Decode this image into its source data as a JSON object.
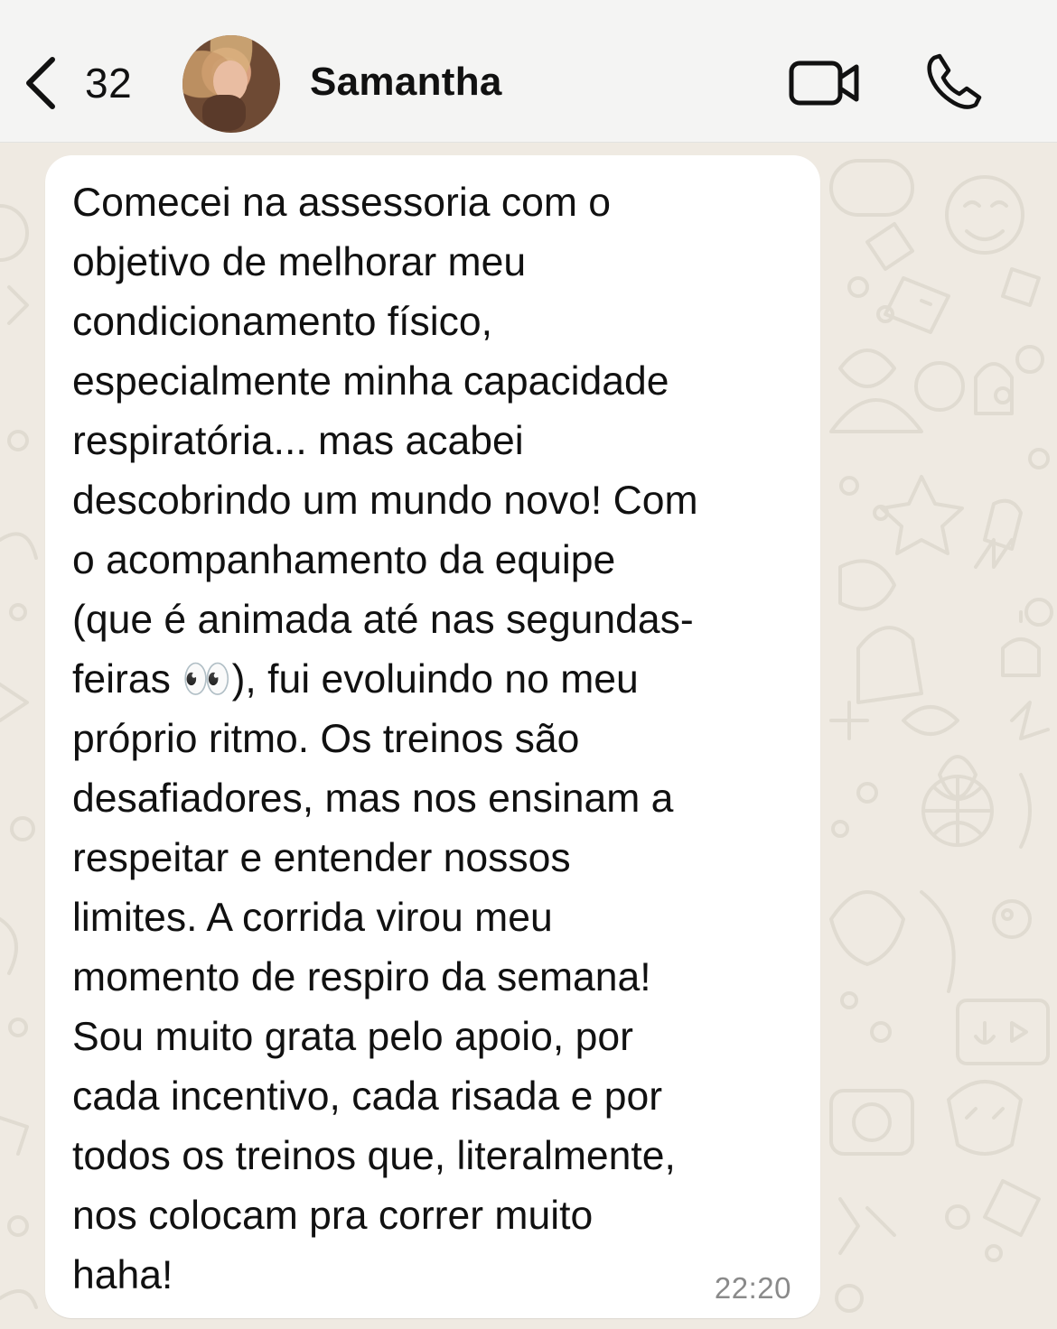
{
  "header": {
    "unread_count": "32",
    "contact_name": "Samantha"
  },
  "message": {
    "lines": [
      "Comecei na assessoria com o",
      "objetivo de melhorar meu",
      "condicionamento físico,",
      "especialmente minha capacidade",
      "respiratória... mas acabei",
      "descobrindo um mundo novo! Com",
      "o acompanhamento da equipe",
      "(que é animada até nas segundas-",
      "feiras 👀), fui evoluindo no meu",
      "próprio ritmo. Os treinos são",
      "desafiadores, mas nos ensinam a",
      "respeitar e entender nossos",
      "limites. A corrida virou meu",
      "momento de respiro da semana!",
      "Sou muito grata pelo apoio, por",
      "cada incentivo, cada risada e por",
      "todos os treinos que, literalmente,",
      "nos colocam pra correr muito",
      "haha!"
    ],
    "time": "22:20"
  },
  "colors": {
    "wallpaper": "#efeae2",
    "header_bg": "#f4f4f3",
    "bubble_bg": "#ffffff",
    "timestamp": "#8a8a8a"
  },
  "icons": [
    "chevron-left-icon",
    "video-camera-icon",
    "phone-icon"
  ]
}
